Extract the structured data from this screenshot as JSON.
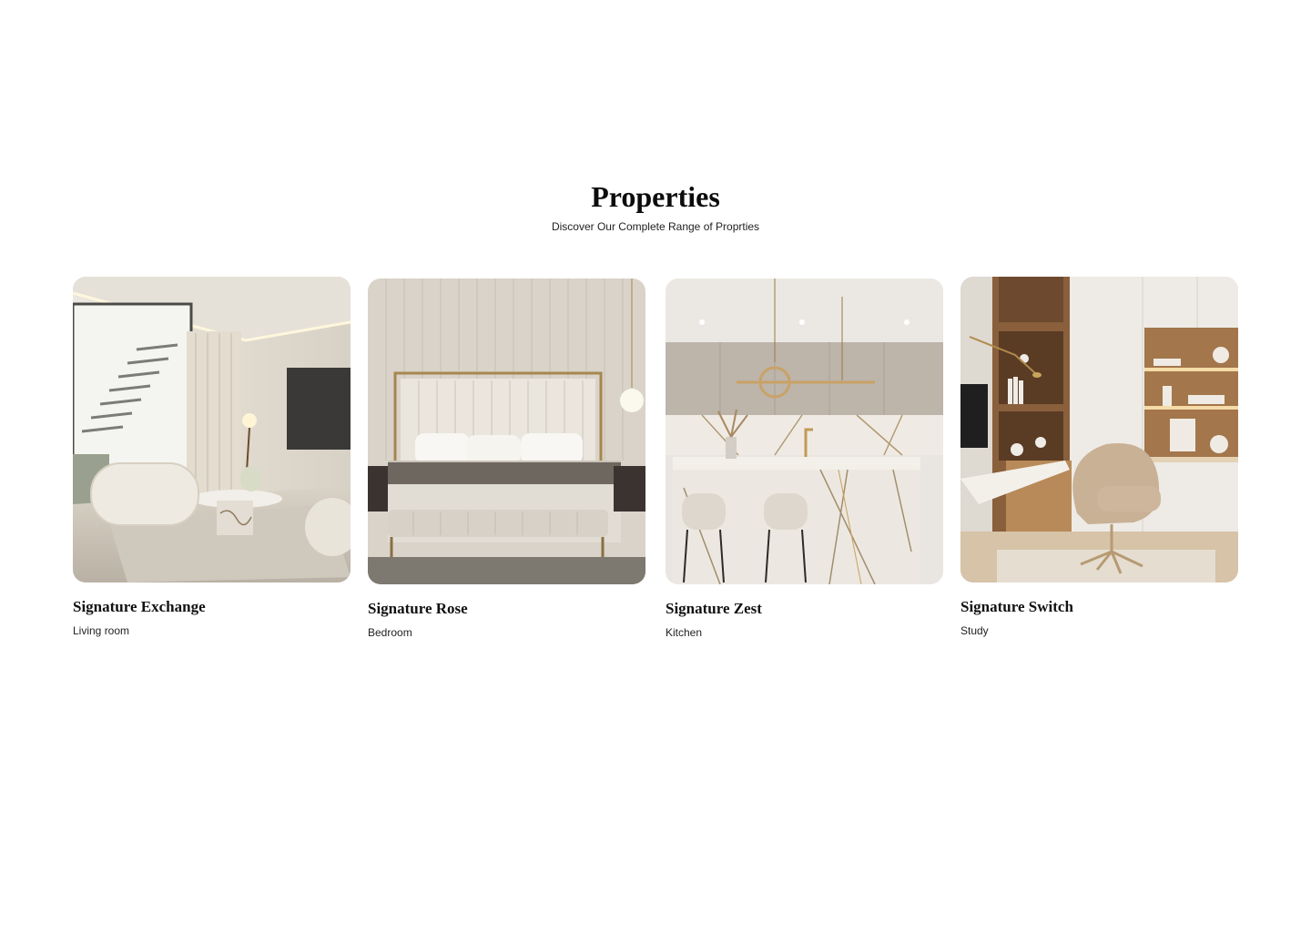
{
  "section": {
    "title": "Properties",
    "subtitle": "Discover Our Complete Range of Proprties"
  },
  "cards": [
    {
      "title": "Signature Exchange",
      "category": "Living room",
      "image": "living-room-photo"
    },
    {
      "title": "Signature Rose",
      "category": "Bedroom",
      "image": "bedroom-photo"
    },
    {
      "title": "Signature Zest",
      "category": "Kitchen",
      "image": "kitchen-photo"
    },
    {
      "title": "Signature Switch",
      "category": "Study",
      "image": "study-photo"
    }
  ]
}
